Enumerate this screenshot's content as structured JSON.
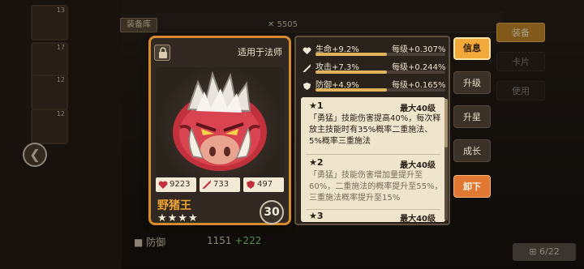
{
  "background": {
    "top_tab": "装备库",
    "coin_value": "5505",
    "portrait_levels": [
      "13",
      "17",
      "12",
      "12"
    ],
    "bottom_stats": [
      {
        "label": "防御",
        "value": "1151",
        "bonus": "+222"
      }
    ],
    "right_menu": [
      "装备",
      "卡片",
      "使用"
    ],
    "page_indicator": "6/22"
  },
  "card": {
    "applicable": "适用于法师",
    "name": "野猪王",
    "stars": "★★★★",
    "level": "30",
    "stats": [
      {
        "icon": "heart-icon",
        "value": "9223"
      },
      {
        "icon": "sword-icon",
        "value": "733"
      },
      {
        "icon": "shield-icon",
        "value": "497"
      }
    ]
  },
  "info": {
    "rows": [
      {
        "icon": "heart-icon",
        "label": "生命+9.2%",
        "per_level": "每级+0.307%",
        "fill": 0.55
      },
      {
        "icon": "sword-icon",
        "label": "攻击+7.3%",
        "per_level": "每级+0.244%",
        "fill": 0.55
      },
      {
        "icon": "shield-icon",
        "label": "防御+4.9%",
        "per_level": "每级+0.165%",
        "fill": 0.55
      }
    ],
    "skills": [
      {
        "star": "★1",
        "max": "最大40级",
        "text": "「勇猛」技能伤害提高40%，每次释放主技能时有35%概率二重施法、5%概率三重施法"
      },
      {
        "star": "★2",
        "max": "最大40级",
        "text": "「勇猛」技能伤害增加量提升至60%，二重施法的概率提升至55%，三重施法概率提升至15%"
      },
      {
        "star": "★3",
        "max": "最大40级",
        "text": ""
      }
    ]
  },
  "actions": [
    "信息",
    "升级",
    "升星",
    "成长",
    "卸下"
  ],
  "colors": {
    "accent": "#f2a93a",
    "card_border": "#d58a2c",
    "danger": "#e07834"
  }
}
